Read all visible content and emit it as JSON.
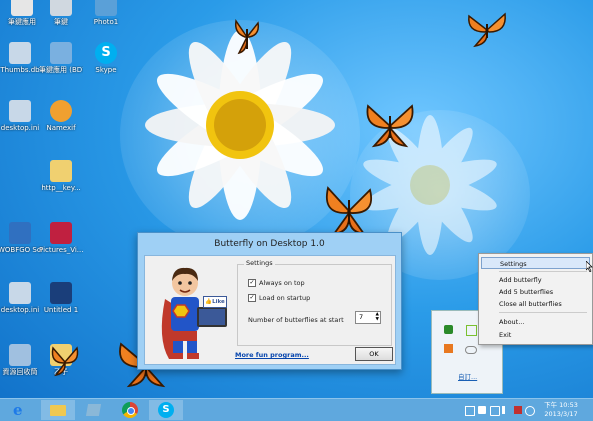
{
  "desktop": {
    "icons": [
      {
        "label": "筆鍵應用",
        "color": "#e6e6e6"
      },
      {
        "label": "筆鍵",
        "color": "#d0d8e0"
      },
      {
        "label": "Photo1",
        "color": "#5aa0d8"
      },
      {
        "label": "Thumbs.db",
        "color": "#c8d8e8"
      },
      {
        "label": "筆鍵應用 (BD7EA470)",
        "color": "#7ab0e0"
      },
      {
        "label": "Skype",
        "color": "#00aff0"
      },
      {
        "label": "desktop.ini",
        "color": "#c8d8e8"
      },
      {
        "label": "Namexif",
        "color": "#f0a030"
      },
      {
        "label": "http__key...",
        "color": "#f0d070"
      },
      {
        "label": "WOBFGO Screenshag",
        "color": "#3070c0"
      },
      {
        "label": "Pictures_Vi...",
        "color": "#c02040"
      },
      {
        "label": "desktop.ini",
        "color": "#c8d8e8"
      },
      {
        "label": "Untitled 1",
        "color": "#1a3e7a"
      },
      {
        "label": "資源回收筒",
        "color": "#a0c0e0"
      },
      {
        "label": "乙子",
        "color": "#f0d070"
      }
    ]
  },
  "dialog": {
    "title": "Butterfly on Desktop 1.0",
    "settings_legend": "Settings",
    "always_on_top": "Always on top",
    "load_on_startup": "Load on startup",
    "butterflies_label": "Number of butterflies at start",
    "butterflies_value": "7",
    "like_label": "Like",
    "more_link": "More fun program...",
    "ok_label": "OK",
    "always_on_top_checked": true,
    "load_on_startup_checked": true
  },
  "context_menu": {
    "items": [
      "Settings",
      "Add butterfly",
      "Add 5 butterflies",
      "Close all butterflies",
      "About...",
      "Exit"
    ],
    "selected_index": 0
  },
  "tray_popup": {
    "customize_label": "自訂..."
  },
  "taskbar": {
    "apps": [
      "Internet Explorer",
      "File Explorer",
      "Windows Store",
      "Chrome",
      "Skype"
    ],
    "time": "下午 10:53",
    "date": "2013/3/17",
    "accent": "#5fa8de"
  }
}
